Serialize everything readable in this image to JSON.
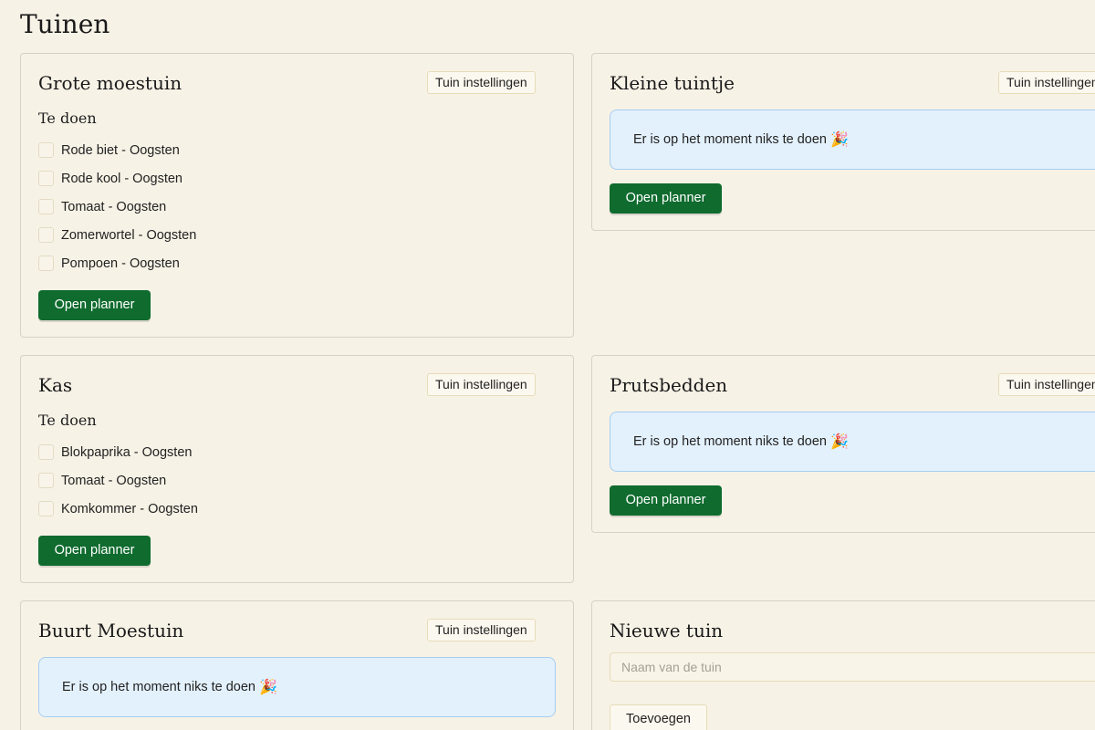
{
  "page": {
    "title": "Tuinen"
  },
  "labels": {
    "settings": "Tuin instellingen",
    "todo_heading": "Te doen",
    "open_planner": "Open planner",
    "nothing_to_do": "Er is op het moment niks te doen",
    "party_icon": "🎉"
  },
  "gardens": [
    {
      "name": "Grote moestuin",
      "todos": [
        "Rode biet - Oogsten",
        "Rode kool - Oogsten",
        "Tomaat - Oogsten",
        "Zomerwortel - Oogsten",
        "Pompoen - Oogsten"
      ]
    },
    {
      "name": "Kleine tuintje",
      "todos": []
    },
    {
      "name": "Kas",
      "todos": [
        "Blokpaprika - Oogsten",
        "Tomaat - Oogsten",
        "Komkommer - Oogsten"
      ]
    },
    {
      "name": "Prutsbedden",
      "todos": []
    },
    {
      "name": "Buurt Moestuin",
      "todos": []
    }
  ],
  "new_garden": {
    "title": "Nieuwe tuin",
    "placeholder": "Naam van de tuin",
    "add_label": "Toevoegen"
  },
  "colors": {
    "background": "#f7f2e6",
    "primary_button": "#0f6b2e",
    "info_background": "#e3f1fd",
    "info_border": "#a6cdef"
  }
}
